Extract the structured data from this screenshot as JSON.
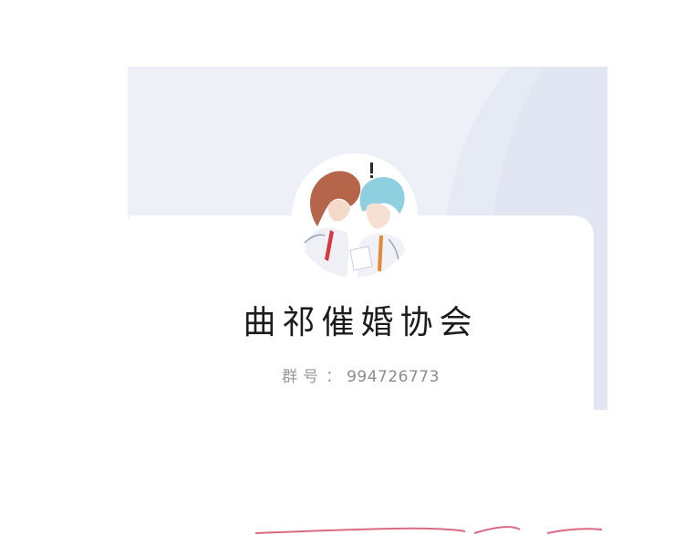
{
  "group": {
    "name": "曲祁催婚协会",
    "id_label": "群号",
    "id_separator": "：",
    "id_value": "994726773"
  },
  "avatar": {
    "icon": "anime-couple-avatar-icon"
  },
  "colors": {
    "header_bg": "#eef0f7",
    "header_swoosh": "#e4e8f3",
    "card_bg": "#ffffff",
    "name_text": "#1c1c1c",
    "id_text": "#9a9a9a",
    "decor_line": "#d86a83"
  }
}
